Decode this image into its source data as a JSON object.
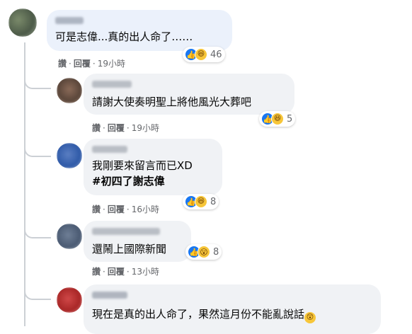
{
  "comments": [
    {
      "text": [
        "可是志偉...真的出人命了……"
      ],
      "reactions": [
        "like",
        "haha"
      ],
      "count": "46",
      "actions": {
        "like": "讚",
        "reply": "回覆",
        "time": "19小時"
      }
    },
    {
      "text": [
        "請謝大使奏明聖上將他風光大葬吧"
      ],
      "reactions": [
        "like",
        "haha"
      ],
      "count": "5",
      "actions": {
        "like": "讚",
        "reply": "回覆",
        "time": "19小時"
      }
    },
    {
      "text": [
        "我剛要來留言而已XD",
        "#初四了謝志偉"
      ],
      "reactions": [
        "like",
        "haha"
      ],
      "count": "8",
      "actions": {
        "like": "讚",
        "reply": "回覆",
        "time": "16小時"
      }
    },
    {
      "text": [
        "還鬧上國際新聞"
      ],
      "reactions": [
        "like",
        "wow"
      ],
      "count": "8",
      "actions": {
        "like": "讚",
        "reply": "回覆",
        "time": "13小時"
      }
    },
    {
      "text": [
        "現在是真的出人命了，果然這月份不能亂說話"
      ],
      "reactions": [],
      "count": "",
      "actions": {}
    }
  ],
  "icons": {
    "like": "like-icon",
    "haha": "haha-icon",
    "wow": "wow-icon",
    "surprised": "surprised-emoji-icon"
  },
  "colors": {
    "like": "#1877f2",
    "emoji": "#f7c639",
    "bubble": "#f0f2f5",
    "highlight": "#ebf1fb",
    "meta": "#65676b"
  },
  "separator": "·"
}
